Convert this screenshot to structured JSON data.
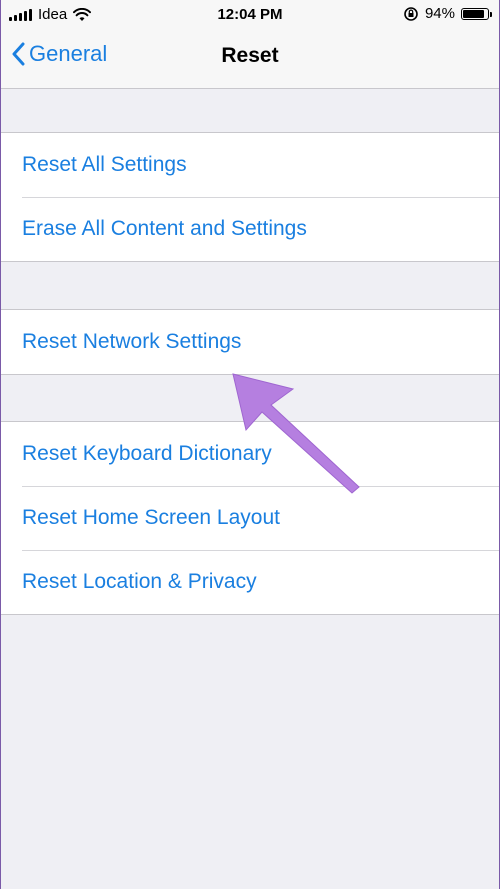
{
  "status_bar": {
    "carrier": "Idea",
    "time": "12:04 PM",
    "battery": "94%",
    "battery_level": 0.94
  },
  "nav": {
    "back_label": "General",
    "title": "Reset"
  },
  "groups": [
    {
      "items": [
        "Reset All Settings",
        "Erase All Content and Settings"
      ]
    },
    {
      "items": [
        "Reset Network Settings"
      ]
    },
    {
      "items": [
        "Reset Keyboard Dictionary",
        "Reset Home Screen Layout",
        "Reset Location & Privacy"
      ]
    }
  ],
  "colors": {
    "accent": "#1a7fe0",
    "background": "#efeff4",
    "annotation_arrow": "#b57fe0"
  },
  "icons": [
    "signal-icon",
    "wifi-icon",
    "orientation-lock-icon",
    "battery-icon",
    "chevron-left-icon",
    "annotation-arrow-icon"
  ]
}
